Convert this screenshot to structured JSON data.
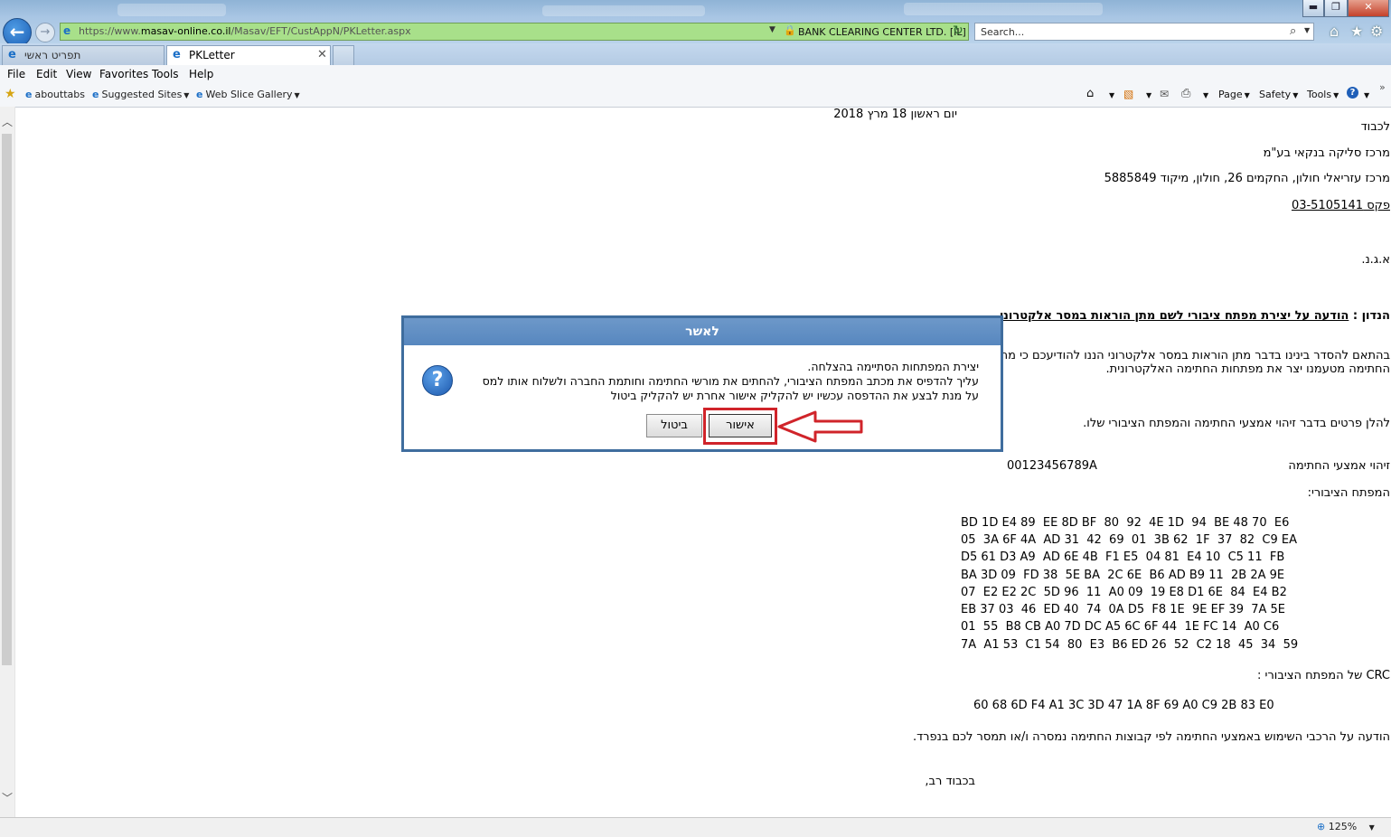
{
  "browser": {
    "url_prefix": "https://www.",
    "url_domain": "masav-online.co.il",
    "url_path": "/Masav/EFT/CustAppN/PKLetter.aspx",
    "cert_label": "BANK CLEARING CENTER LTD. [IL]",
    "search_placeholder": "Search...",
    "tabs": [
      {
        "label": "תפריט ראשי"
      },
      {
        "label": "PKLetter"
      }
    ],
    "menu": [
      "File",
      "Edit",
      "View",
      "Favorites",
      "Tools",
      "Help"
    ],
    "favorites": [
      "abouttabs",
      "Suggested Sites",
      "Web Slice Gallery"
    ],
    "commands": [
      "Page",
      "Safety",
      "Tools"
    ],
    "zoom_label": "125%"
  },
  "letter": {
    "date": "יום ראשון 18 מרץ 2018",
    "to": "לכבוד",
    "org": "מרכז סליקה בנקאי בע\"מ",
    "address": "מרכז עזריאלי חולון, החקמים 26, חולון, מיקוד 5885849",
    "fax": "פקס 03-5105141",
    "greeting": "א.ג.נ.",
    "subject_label": "הנדון :",
    "subject": "הודעה על יצירת מפתח ציבורי לשם מתן הוראות במסר אלקטרוני",
    "para1_line1": "בהתאם להסדר בינינו בדבר מתן הוראות במסר אלקטרוני הננו להודיעכם כי מחזיק",
    "para1_line2": "החתימה מטעמנו יצר את מפתחות החתימה האלקטרונית.",
    "para2": "להלן פרטים בדבר זיהוי אמצעי החתימה והמפתח הציבורי שלו.",
    "signer_id_label": "זיהוי אמצעי החתימה",
    "signer_id_value": "00123456789A",
    "public_key_label": "המפתח הציבורי:",
    "public_key_lines": [
      "BD 1D E4 89  EE 8D BF  80  92  4E 1D  94  BE 48 70  E6",
      "05  3A 6F 4A  AD 31  42  69  01  3B 62  1F  37  82  C9 EA",
      "D5 61 D3 A9  AD 6E 4B  F1 E5  04 81  E4 10  C5 11  FB",
      "BA 3D 09  FD 38  5E BA  2C 6E  B6 AD B9 11  2B 2A 9E",
      "07  E2 E2 2C  5D 96  11  A0 09  19 E8 D1 6E  84  E4 B2",
      "EB 37 03  46  ED 40  74  0A D5  F8 1E  9E EF 39  7A 5E",
      "01  55  B8 CB A0 7D DC A5 6C 6F 44  1E FC 14  A0 C6",
      "7A  A1 53  C1 54  80  E3  B6 ED 26  52  C2 18  45  34  59"
    ],
    "crc_label": "CRC של המפתח הציבורי :",
    "crc_value": "60 68 6D F4 A1 3C 3D 47 1A 8F 69 A0 C9 2B 83 E0",
    "notice": "הודעה על הרכבי השימוש באמצעי החתימה לפי קבוצות החתימה נמסרה ו/או תמסר לכם בנפרד.",
    "closing": "בכבוד רב,"
  },
  "dialog": {
    "title": "לאשר",
    "line1": "יצירת המפתחות הסתיימה בהצלחה.",
    "line2": "עליך להדפיס את מכתב המפתח הציבורי, להחתים את מורשי החתימה וחותמת החברה ולשלוח אותו למס",
    "line3": "על מנת לבצע את ההדפסה עכשיו יש להקליק אישור אחרת יש להקליק ביטול",
    "ok_label": "אישור",
    "cancel_label": "ביטול"
  },
  "colors": {
    "address_bar": "#a8e08a",
    "dialog_title": "#5f8fc5",
    "highlight": "#d0242a"
  }
}
